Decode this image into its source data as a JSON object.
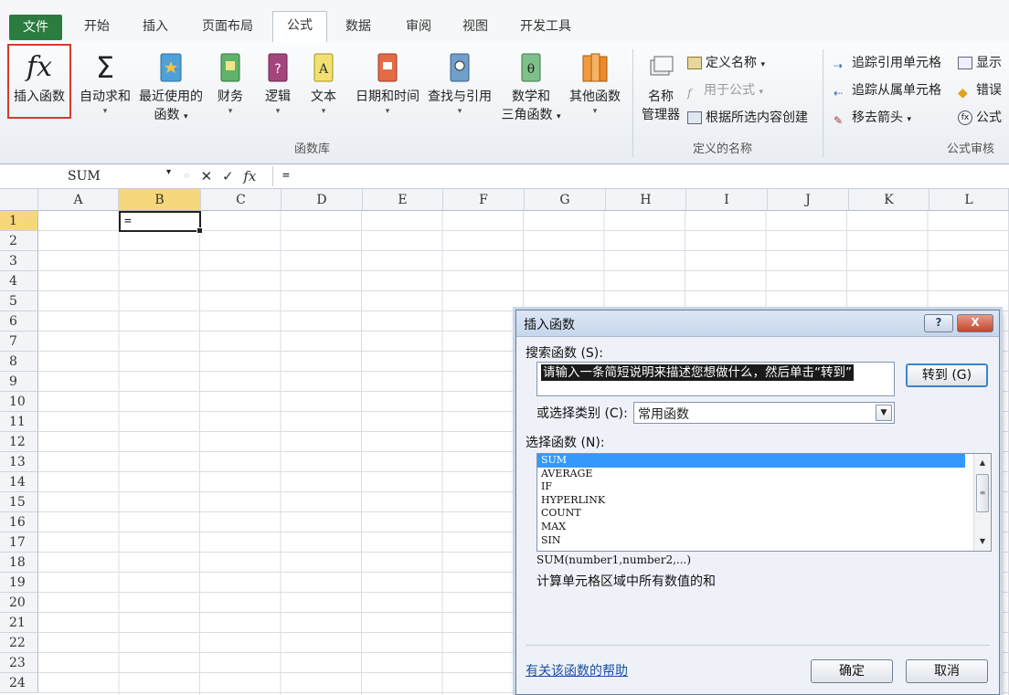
{
  "tabs": {
    "file": "文件",
    "home": "开始",
    "insert": "插入",
    "page_layout": "页面布局",
    "formulas": "公式",
    "data": "数据",
    "review": "审阅",
    "view": "视图",
    "developer": "开发工具"
  },
  "ribbon": {
    "insert_function": "插入函数",
    "autosum": "自动求和",
    "recent_1": "最近使用的",
    "recent_2": "函数",
    "financial": "财务",
    "logical": "逻辑",
    "text": "文本",
    "datetime": "日期和时间",
    "lookup": "查找与引用",
    "math_1": "数学和",
    "math_2": "三角函数",
    "other": "其他函数",
    "function_library_label": "函数库",
    "name_mgr_1": "名称",
    "name_mgr_2": "管理器",
    "define_name": "定义名称",
    "use_in_formula": "用于公式",
    "create_from_selection": "根据所选内容创建",
    "defined_names_label": "定义的名称",
    "trace_precedents": "追踪引用单元格",
    "trace_dependents": "追踪从属单元格",
    "remove_arrows": "移去箭头",
    "show_formulas": "显示",
    "error_checking": "错误",
    "evaluate_formula": "公式",
    "formula_auditing_label": "公式审核"
  },
  "formula_bar": {
    "name_box": "SUM",
    "content": "="
  },
  "sheet": {
    "columns": [
      "A",
      "B",
      "C",
      "D",
      "E",
      "F",
      "G",
      "H",
      "I",
      "J",
      "K",
      "L"
    ],
    "rows": [
      "1",
      "2",
      "3",
      "4",
      "5",
      "6",
      "7",
      "8",
      "9",
      "10",
      "11",
      "12",
      "13",
      "14",
      "15",
      "16",
      "17",
      "18",
      "19",
      "20",
      "21",
      "22",
      "23",
      "24"
    ],
    "active_cell_value": "="
  },
  "dialog": {
    "title": "插入函数",
    "help_btn": "?",
    "close_btn": "X",
    "search_label": "搜索函数 (S):",
    "search_text": "请输入一条简短说明来描述您想做什么，然后单击“转到”",
    "goto_btn": "转到 (G)",
    "category_label": "或选择类别 (C):",
    "category_value": "常用函数",
    "select_label": "选择函数 (N):",
    "functions": [
      "SUM",
      "AVERAGE",
      "IF",
      "HYPERLINK",
      "COUNT",
      "MAX",
      "SIN"
    ],
    "signature": "SUM(number1,number2,...)",
    "description": "计算单元格区域中所有数值的和",
    "help_link": "有关该函数的帮助",
    "ok": "确定",
    "cancel": "取消"
  }
}
